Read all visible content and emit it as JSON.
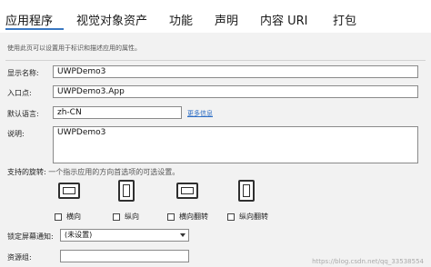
{
  "tabs": [
    {
      "label": "应用程序"
    },
    {
      "label": "视觉对象资产"
    },
    {
      "label": "功能"
    },
    {
      "label": "声明"
    },
    {
      "label": "内容 URI"
    },
    {
      "label": "打包"
    }
  ],
  "active_tab_index": 0,
  "description": "使用此页可以设置用于标识和描述应用的属性。",
  "fields": {
    "display_name": {
      "label": "显示名称:",
      "value": "UWPDemo3"
    },
    "entry_point": {
      "label": "入口点:",
      "value": "UWPDemo3.App"
    },
    "default_language": {
      "label": "默认语言:",
      "value": "zh-CN",
      "link": "更多信息"
    },
    "description": {
      "label": "说明:",
      "value": "UWPDemo3"
    }
  },
  "rotation": {
    "label": "支持的旋转:",
    "hint": "一个指示应用的方向首选项的可选设置。",
    "options": [
      {
        "label": "横向",
        "icon": "landscape-device-icon",
        "checked": false
      },
      {
        "label": "纵向",
        "icon": "portrait-device-icon",
        "checked": false
      },
      {
        "label": "横向翻转",
        "icon": "landscape-flipped-device-icon",
        "checked": false
      },
      {
        "label": "纵向翻转",
        "icon": "portrait-flipped-device-icon",
        "checked": false
      }
    ]
  },
  "lock_screen": {
    "label": "锁定屏幕通知:",
    "value": "(未设置)"
  },
  "resource_group": {
    "label": "资源组:",
    "value": ""
  },
  "watermark": "https://blog.csdn.net/qq_33538554",
  "colors": {
    "accent": "#3a78c2",
    "link": "#2b6cc4"
  }
}
